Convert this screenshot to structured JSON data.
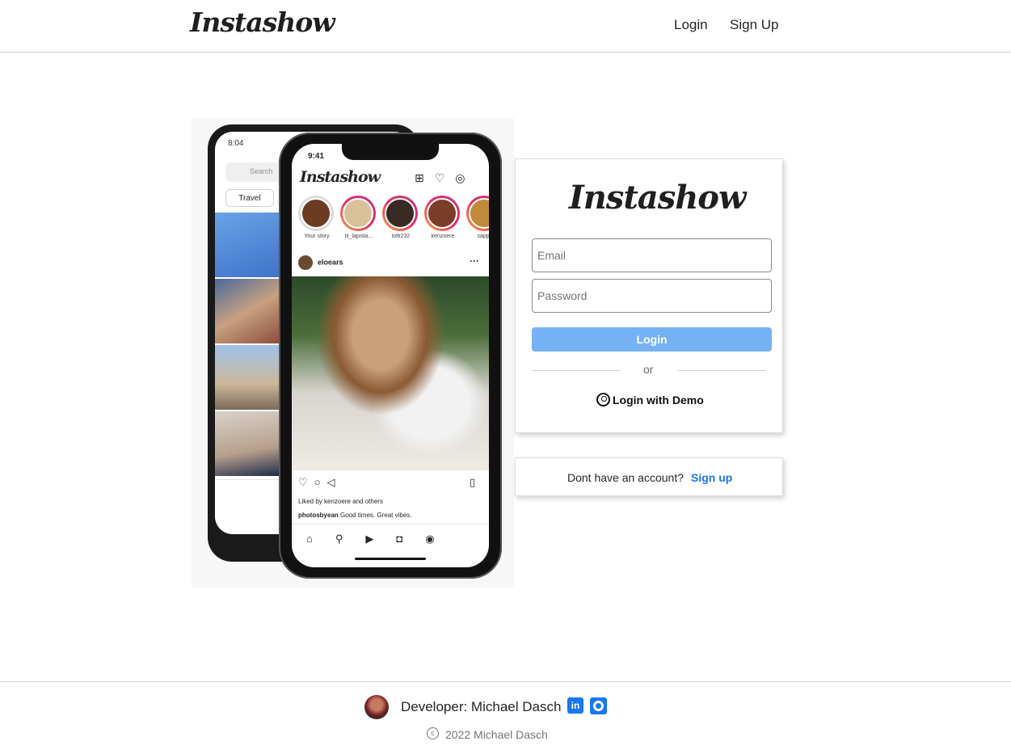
{
  "header": {
    "brand": "Instashow",
    "nav": {
      "login": "Login",
      "signup": "Sign Up"
    }
  },
  "mock": {
    "back_phone": {
      "time": "8:04",
      "search_placeholder": "Search",
      "chip": "Travel"
    },
    "front_phone": {
      "time": "9:41",
      "logo": "Instashow",
      "stories": [
        "Your story",
        "lil_lapisla...",
        "lofti232",
        "kenzoere",
        "sapph"
      ],
      "post_user": "eloears",
      "liked_by": "Liked by kenzoere and others",
      "caption_user": "photosbyean",
      "caption_text": "Good times. Great vibes."
    }
  },
  "login_card": {
    "logo": "Instashow",
    "email_placeholder": "Email",
    "password_placeholder": "Password",
    "login_button": "Login",
    "divider": "or",
    "demo_login": "Login with Demo"
  },
  "signup_card": {
    "prompt": "Dont have an account?",
    "link": "Sign up"
  },
  "footer": {
    "developer": "Developer: Michael Dasch",
    "linkedin_icon": "in",
    "copyright_symbol": "c",
    "copyright": "2022 Michael Dasch"
  },
  "colors": {
    "accent": "#1877f2",
    "login_button": "#75b2f5"
  }
}
